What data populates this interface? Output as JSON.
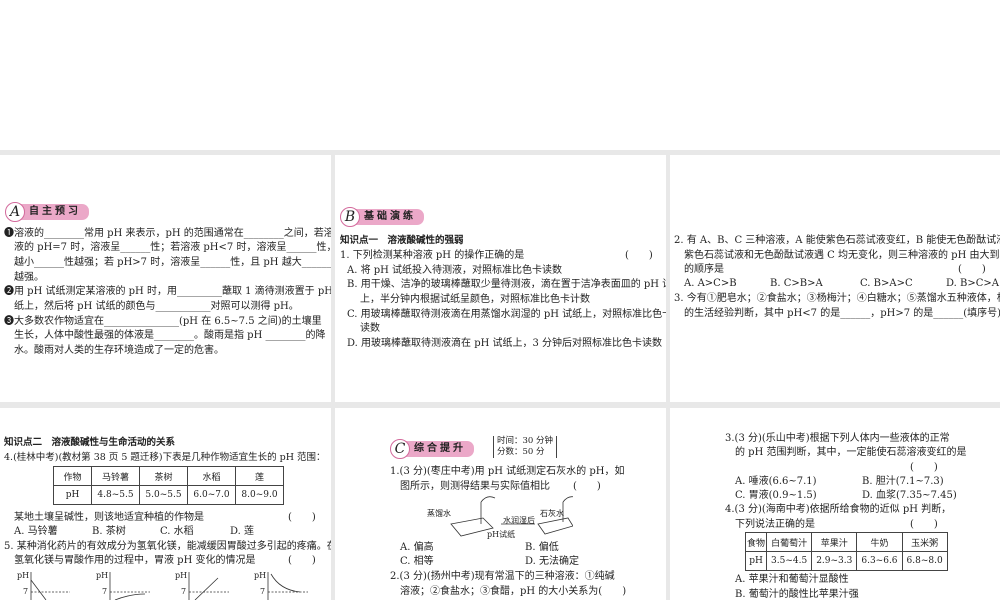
{
  "p1": {
    "badge": "A",
    "title": "自主预习",
    "lines": [
      "❶溶液的________常用 pH 来表示，pH 的范围通常在________之间，若溶",
      "液的 pH=7 时，溶液呈______性；若溶液 pH<7 时，溶液呈______性，且 pH",
      "越小______性越强；若 pH>7 时，溶液呈______性，且 pH 越大______性",
      "越强。",
      "❷用 pH 试纸测定某溶液的 pH 时，用_________蘸取 1 滴待测液置于 pH 试",
      "纸上，然后将 pH 试纸的颜色与___________对照可以测得 pH。",
      "❸大多数农作物适宜在_______________(pH 在 6.5~7.5 之间)的土壤里",
      "生长，人体中酸性最强的体液是________。酸雨是指 pH ________的降",
      "水。酸雨对人类的生存环境造成了一定的危害。"
    ]
  },
  "p2": {
    "badge": "B",
    "title": "基础演练",
    "kp": "知识点一　溶液酸碱性的强弱",
    "lines": [
      "1. 下列检测某种溶液 pH 的操作正确的是",
      "A. 将 pH 试纸投入待测液，对照标准比色卡读数",
      "B. 用干燥、洁净的玻璃棒蘸取少量待测液，滴在置于洁净表面皿的 pH 试纸",
      "上，半分钟内根据试纸呈颜色，对照标准比色卡计数",
      "C. 用玻璃棒蘸取待测液滴在用蒸馏水润湿的 pH 试纸上，对照标准比色卡",
      "读数",
      "D. 用玻璃棒蘸取待测液滴在 pH 试纸上，3 分钟后对照标准比色卡读数"
    ],
    "paren": "(　　)"
  },
  "p3": {
    "lines": [
      "2. 有 A、B、C 三种溶液，A 能使紫色石蕊试液变红，B 能使无色酚酞试液变红，",
      "紫色石蕊试液和无色酚酞试液遇 C 均无变化，则三种溶液的 pH 由大到小",
      "的顺序是"
    ],
    "paren": "(　　)",
    "options": [
      "A. A>C>B",
      "B. C>B>A",
      "C. B>A>C",
      "D. B>C>A"
    ],
    "q3": [
      "3. 今有①肥皂水；②食盐水；③杨梅汁；④白糖水；⑤蒸馏水五种液体，根据你",
      "的生活经验判断，其中 pH<7 的是______，pH>7 的是______(填序号)。"
    ]
  },
  "p4": {
    "kp": "知识点二　溶液酸碱性与生命活动的关系",
    "q4": "4.(桂林中考)(教材第 38 页 5 题迁移)下表是几种作物适宜生长的 pH 范围：",
    "table": {
      "header": [
        "作物",
        "马铃薯",
        "茶树",
        "水稻",
        "莲"
      ],
      "row": [
        "pH",
        "4.8~5.5",
        "5.0~5.5",
        "6.0~7.0",
        "8.0~9.0"
      ]
    },
    "q4b": "某地土壤呈碱性，则该地适宜种植的作物是",
    "paren": "(　　)",
    "options": [
      "A. 马铃薯",
      "B. 茶树",
      "C. 水稻",
      "D. 莲"
    ],
    "q5": [
      "5. 某种消化药片的有效成分为氢氧化镁，能减缓因胃酸过多引起的疼痛。在",
      "氢氧化镁与胃酸作用的过程中，胃液 pH 变化的情况是"
    ],
    "graph_y": "pH",
    "graph_tick": "7"
  },
  "p5": {
    "badge": "C",
    "title": "综合提升",
    "time": "时间：30 分钟",
    "score": "分数：50 分",
    "q1": [
      "1.(3 分)(枣庄中考)用 pH 试纸测定石灰水的 pH，如",
      "图所示，则测得结果与实际值相比"
    ],
    "paren": "(　　)",
    "fig": {
      "water": "蒸馏水",
      "after": "水润湿后",
      "lime": "石灰水",
      "paper": "pH试纸"
    },
    "options": [
      "A. 偏高",
      "B. 偏低",
      "C. 相等",
      "D. 无法确定"
    ],
    "q2": [
      "2.(3 分)(扬州中考)现有常温下的三种溶液：①纯碱",
      "溶液；②食盐水；③食醋，pH 的大小关系为(　　)"
    ]
  },
  "p6": {
    "q3": [
      "3.(3 分)(乐山中考)根据下列人体内一些液体的正常",
      "的 pH 范围判断，其中，一定能使石蕊溶液变红的是"
    ],
    "paren": "(　　)",
    "options": [
      "A. 唾液(6.6~7.1)",
      "B. 胆汁(7.1~7.3)",
      "C. 胃液(0.9~1.5)",
      "D. 血浆(7.35~7.45)"
    ],
    "q4": [
      "4.(3 分)(海南中考)依据所给食物的近似 pH 判断，",
      "下列说法正确的是"
    ],
    "table": {
      "header": [
        "食物",
        "白葡萄汁",
        "苹果汁",
        "牛奶",
        "玉米粥"
      ],
      "row": [
        "pH",
        "3.5~4.5",
        "2.9~3.3",
        "6.3~6.6",
        "6.8~8.0"
      ]
    },
    "answers": [
      "A. 苹果汁和葡萄汁显酸性",
      "B. 葡萄汁的酸性比苹果汁强"
    ]
  }
}
